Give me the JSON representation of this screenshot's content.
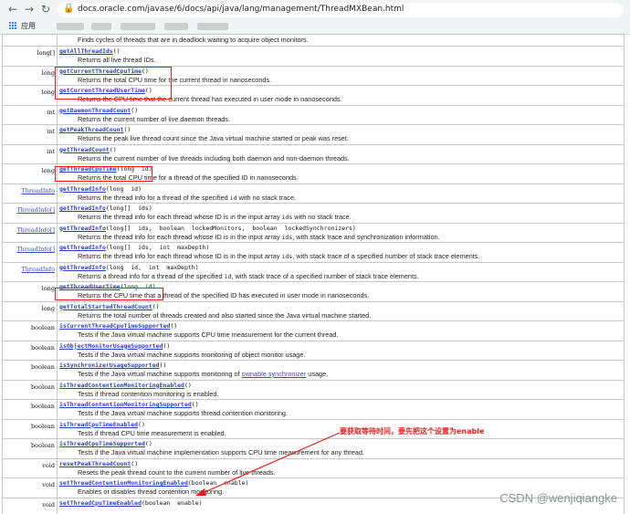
{
  "browser": {
    "url": "docs.oracle.com/javase/6/docs/api/java/lang/management/ThreadMXBean.html",
    "apps_label": "应用"
  },
  "top_description": "Finds cycles of threads that are in deadlock waiting to acquire object monitors.",
  "rows": [
    {
      "type": "long[]",
      "type_link": false,
      "name": "getAllThreadIds",
      "params": "()",
      "desc": [
        {
          "t": "Returns all live thread IDs."
        }
      ]
    },
    {
      "type": "long",
      "type_link": false,
      "name": "getCurrentThreadCpuTime",
      "params": "()",
      "desc": [
        {
          "t": "Returns the total CPU time for the current thread in nanoseconds."
        }
      ]
    },
    {
      "type": "long",
      "type_link": false,
      "name": "getCurrentThreadUserTime",
      "params": "()",
      "desc": [
        {
          "t": "Returns the CPU time that the current thread has executed in user mode in nanoseconds."
        }
      ]
    },
    {
      "type": "int",
      "type_link": false,
      "name": "getDaemonThreadCount",
      "params": "()",
      "desc": [
        {
          "t": "Returns the current number of live daemon threads."
        }
      ]
    },
    {
      "type": "int",
      "type_link": false,
      "name": "getPeakThreadCount",
      "params": "()",
      "desc": [
        {
          "t": "Returns the peak live thread count since the Java virtual machine started or peak was reset."
        }
      ]
    },
    {
      "type": "int",
      "type_link": false,
      "name": "getThreadCount",
      "params": "()",
      "desc": [
        {
          "t": "Returns the current number of live threads including both daemon and non-daemon threads."
        }
      ]
    },
    {
      "type": "long",
      "type_link": false,
      "name": "getThreadCpuTime",
      "params": "(long  id)",
      "desc": [
        {
          "t": "Returns the total CPU time for a thread of the specified ID in nanoseconds."
        }
      ]
    },
    {
      "type": "ThreadInfo",
      "type_link": true,
      "name": "getThreadInfo",
      "params": "(long  id)",
      "desc": [
        {
          "t": "Returns the thread info for a thread of the specified "
        },
        {
          "t": "id",
          "c": true
        },
        {
          "t": " with no stack trace."
        }
      ]
    },
    {
      "type": "ThreadInfo[]",
      "type_link": true,
      "name": "getThreadInfo",
      "params": "(long[]  ids)",
      "desc": [
        {
          "t": "Returns the thread info for each thread whose ID is in the input array "
        },
        {
          "t": "ids",
          "c": true
        },
        {
          "t": " with no stack trace."
        }
      ]
    },
    {
      "type": "ThreadInfo[]",
      "type_link": true,
      "name": "getThreadInfo",
      "params": "(long[]  ids,  boolean  lockedMonitors,  boolean  lockedSynchronizers)",
      "desc": [
        {
          "t": "Returns the thread info for each thread whose ID is in the input array "
        },
        {
          "t": "ids",
          "c": true
        },
        {
          "t": ", with stack trace and synchronization information."
        }
      ]
    },
    {
      "type": "ThreadInfo[]",
      "type_link": true,
      "name": "getThreadInfo",
      "params": "(long[]  ids,  int  maxDepth)",
      "desc": [
        {
          "t": "Returns the thread info for each thread whose ID is in the input array "
        },
        {
          "t": "ids",
          "c": true
        },
        {
          "t": ", with stack trace of a specified number of stack trace elements."
        }
      ]
    },
    {
      "type": "ThreadInfo",
      "type_link": true,
      "name": "getThreadInfo",
      "params": "(long  id,  int  maxDepth)",
      "desc": [
        {
          "t": "Returns a thread info for a thread of the specified "
        },
        {
          "t": "id",
          "c": true
        },
        {
          "t": ", with stack trace of a specified number of stack trace elements."
        }
      ]
    },
    {
      "type": "long",
      "type_link": false,
      "name": "getThreadUserTime",
      "params": "(long  id)",
      "desc": [
        {
          "t": "Returns the CPU time that a thread of the specified ID has executed in user mode in nanoseconds."
        }
      ]
    },
    {
      "type": "long",
      "type_link": false,
      "name": "getTotalStartedThreadCount",
      "params": "()",
      "desc": [
        {
          "t": "Returns the total number of threads created and also started since the Java virtual machine started."
        }
      ]
    },
    {
      "type": "boolean",
      "type_link": false,
      "name": "isCurrentThreadCpuTimeSupported",
      "params": "()",
      "desc": [
        {
          "t": "Tests if the Java virtual machine supports CPU time measurement for the current thread."
        }
      ]
    },
    {
      "type": "boolean",
      "type_link": false,
      "name": "isObjectMonitorUsageSupported",
      "params": "()",
      "desc": [
        {
          "t": "Tests if the Java virtual machine supports monitoring of object monitor usage."
        }
      ]
    },
    {
      "type": "boolean",
      "type_link": false,
      "name": "isSynchronizerUsageSupported",
      "params": "()",
      "desc": [
        {
          "t": "Tests if the Java virtual machine supports monitoring of "
        },
        {
          "t": "ownable synchronizer",
          "l": true
        },
        {
          "t": " usage."
        }
      ]
    },
    {
      "type": "boolean",
      "type_link": false,
      "name": "isThreadContentionMonitoringEnabled",
      "params": "()",
      "desc": [
        {
          "t": "Tests if thread contention monitoring is enabled."
        }
      ]
    },
    {
      "type": "boolean",
      "type_link": false,
      "name": "isThreadContentionMonitoringSupported",
      "params": "()",
      "desc": [
        {
          "t": "Tests if the Java virtual machine supports thread contention monitoring."
        }
      ]
    },
    {
      "type": "boolean",
      "type_link": false,
      "name": "isThreadCpuTimeEnabled",
      "params": "()",
      "desc": [
        {
          "t": "Tests if thread CPU time measurement is enabled."
        }
      ]
    },
    {
      "type": "boolean",
      "type_link": false,
      "name": "isThreadCpuTimeSupported",
      "params": "()",
      "desc": [
        {
          "t": "Tests if the Java virtual machine implementation supports CPU time measurement for any thread."
        }
      ]
    },
    {
      "type": "void",
      "type_link": false,
      "name": "resetPeakThreadCount",
      "params": "()",
      "desc": [
        {
          "t": "Resets the peak thread count to the current number of live threads."
        }
      ]
    },
    {
      "type": "void",
      "type_link": false,
      "name": "setThreadContentionMonitoringEnabled",
      "params": "(boolean  enable)",
      "desc": [
        {
          "t": "Enables or disables thread contention monitoring."
        }
      ]
    },
    {
      "type": "void",
      "type_link": false,
      "name": "setThreadCpuTimeEnabled",
      "params": "(boolean  enable)",
      "desc": [
        {
          "t": ""
        }
      ]
    }
  ],
  "annotation": "要获取等待时间，要先把这个设置为enable",
  "watermark": "CSDN @wenjiqiangke",
  "colors": {
    "highlight": "#e02020",
    "link": "#2b3fc7"
  }
}
